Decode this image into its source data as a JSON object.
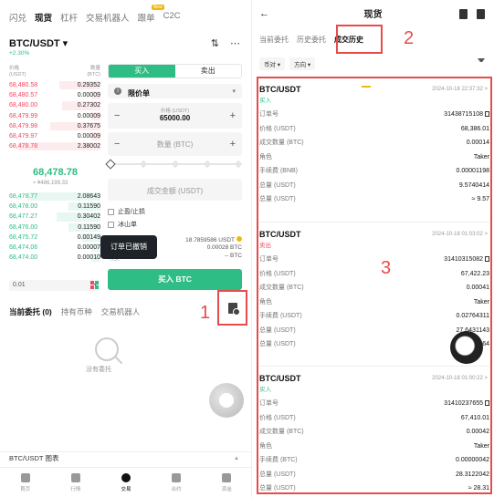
{
  "left": {
    "top_tabs": [
      "闪兑",
      "现货",
      "杠杆",
      "交易机器人",
      "跟单",
      "C2C"
    ],
    "top_tab_badge": "New",
    "pair": "BTC/USDT",
    "pair_caret": "▾",
    "change": "+2.30%",
    "header_icons": [
      "candlestick-icon",
      "more-icon"
    ],
    "orderbook": {
      "price_header": "价格\n(USDT)",
      "qty_header": "数量\n(BTC)",
      "asks": [
        {
          "price": "68,480.58",
          "qty": "0.29352"
        },
        {
          "price": "68,480.57",
          "qty": "0.00009"
        },
        {
          "price": "68,480.00",
          "qty": "0.27302"
        },
        {
          "price": "68,479.99",
          "qty": "0.00009"
        },
        {
          "price": "68,479.98",
          "qty": "0.37675"
        },
        {
          "price": "68,479.97",
          "qty": "0.00009"
        },
        {
          "price": "68,478.78",
          "qty": "2.38002"
        }
      ],
      "mid_price": "68,478.78",
      "mid_sub": "≈ ¥486,199.33",
      "bids": [
        {
          "price": "68,478.77",
          "qty": "2.08643"
        },
        {
          "price": "68,478.00",
          "qty": "0.11590"
        },
        {
          "price": "68,477.27",
          "qty": "0.30402"
        },
        {
          "price": "68,476.00",
          "qty": "0.11590"
        },
        {
          "price": "68,475.72",
          "qty": "0.00149"
        },
        {
          "price": "68,474.06",
          "qty": "0.00007"
        },
        {
          "price": "68,474.00",
          "qty": "0.00010"
        }
      ],
      "depth_value": "0.01"
    },
    "trade": {
      "buy_label": "买入",
      "sell_label": "卖出",
      "order_type": "限价单",
      "price_label": "价格 (USDT)",
      "price_value": "65000.00",
      "qty_placeholder": "数量 (BTC)",
      "total_placeholder": "成交金额 (USDT)",
      "tp_sl_label": "止盈/止损",
      "iceberg_label": "冰山单",
      "avail_usdt": "18.7859586 USDT",
      "avail_btc": "0.00028 BTC",
      "max_label": "-- BTC",
      "max_key": "可买",
      "buy_button": "买入 BTC",
      "toast": "订单已撤销"
    },
    "sub_tabs": [
      "当前委托 (0)",
      "持有币种",
      "交易机器人"
    ],
    "empty_text": "没有委托",
    "chart_label": "BTC/USDT 图表",
    "nav": [
      "首页",
      "行情",
      "交易",
      "合约",
      "资金"
    ],
    "annotation_1": "1"
  },
  "right": {
    "title": "现货",
    "back": "←",
    "tabs": [
      "当前委托",
      "历史委托",
      "成交历史"
    ],
    "filters": [
      "币对 ▾",
      "方向 ▾"
    ],
    "annotation_2": "2",
    "annotation_3": "3",
    "cards": [
      {
        "pair": "BTC/USDT",
        "time": "2024-10-18 22:37:32 >",
        "side": "买入",
        "side_type": "buy",
        "rows": [
          {
            "k": "订单号",
            "v": "31438715108"
          },
          {
            "k": "价格 (USDT)",
            "v": "68,386.01"
          },
          {
            "k": "成交数量 (BTC)",
            "v": "0.00014"
          },
          {
            "k": "角色",
            "v": "Taker"
          },
          {
            "k": "手续费 (BNB)",
            "v": "0.00001198"
          },
          {
            "k": "总量 (USDT)",
            "v": "9.5740414"
          },
          {
            "k": "总量 (USDT)",
            "v": "≈ 9.57"
          }
        ]
      },
      {
        "pair": "BTC/USDT",
        "time": "2024-10-18 01:03:02 >",
        "side": "卖出",
        "side_type": "sell",
        "rows": [
          {
            "k": "订单号",
            "v": "31410315082"
          },
          {
            "k": "价格 (USDT)",
            "v": "67,422.23"
          },
          {
            "k": "成交数量 (BTC)",
            "v": "0.00041"
          },
          {
            "k": "角色",
            "v": "Taker"
          },
          {
            "k": "手续费 (USDT)",
            "v": "0.02764311"
          },
          {
            "k": "总量 (USDT)",
            "v": "27.6431143"
          },
          {
            "k": "总量 (USDT)",
            "v": "≈ 27.64"
          }
        ]
      },
      {
        "pair": "BTC/USDT",
        "time": "2024-10-18 01:00:22 >",
        "side": "买入",
        "side_type": "buy",
        "rows": [
          {
            "k": "订单号",
            "v": "31410237655"
          },
          {
            "k": "价格 (USDT)",
            "v": "67,410.01"
          },
          {
            "k": "成交数量 (BTC)",
            "v": "0.00042"
          },
          {
            "k": "角色",
            "v": "Taker"
          },
          {
            "k": "手续费 (BTC)",
            "v": "0.00000042"
          },
          {
            "k": "总量 (USDT)",
            "v": "28.3122042"
          },
          {
            "k": "总量 (USDT)",
            "v": "≈ 28.31"
          }
        ]
      }
    ]
  },
  "colors": {
    "buy": "#2ebd85",
    "sell": "#f6465d",
    "accent": "#f0b90b",
    "annotation": "#e74c4c"
  }
}
